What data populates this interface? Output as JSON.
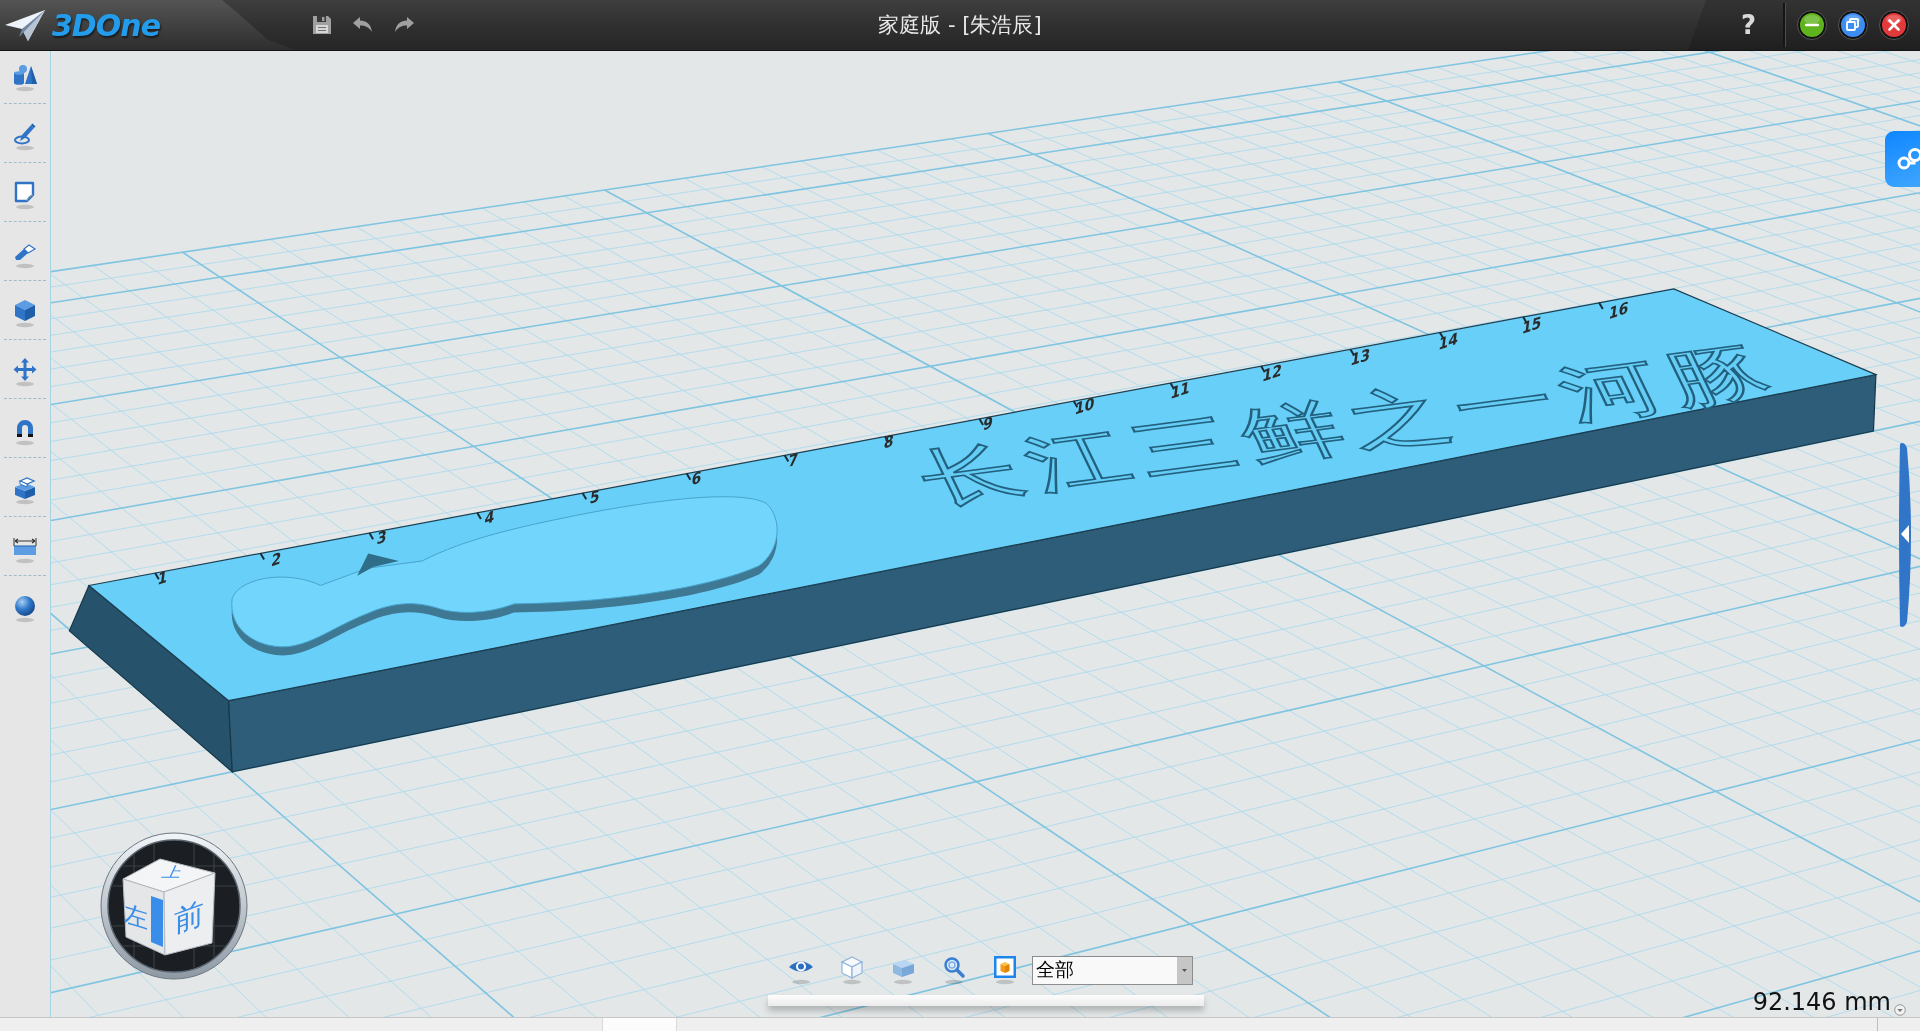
{
  "title_bar": {
    "logo": "3DOne",
    "title": "家庭版 - [朱浩辰]",
    "help": "?"
  },
  "model": {
    "ruler_numbers": [
      "1",
      "2",
      "3",
      "4",
      "5",
      "6",
      "7",
      "8",
      "9",
      "10",
      "11",
      "12",
      "13",
      "14",
      "15",
      "16"
    ],
    "engraving": "长江三鲜之一河豚"
  },
  "view_cube": {
    "top": "上",
    "left": "左",
    "front": "前"
  },
  "bottom_toolbar": {
    "filter": {
      "value": "全部"
    }
  },
  "measurement": "92.146 mm"
}
